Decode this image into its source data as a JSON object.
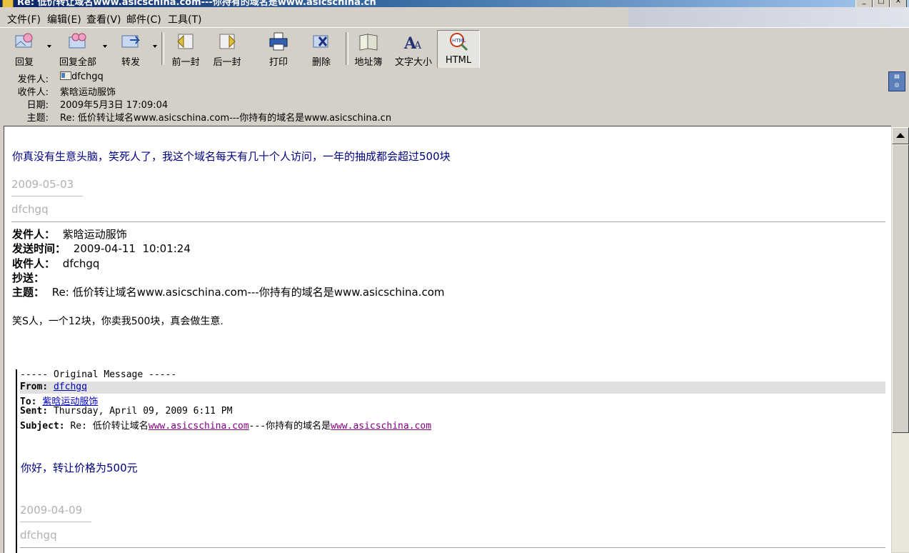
{
  "window": {
    "title": "Re: 低价转让域名www.asicschina.com---你持有的域名是www.asicschina.cn"
  },
  "menu": [
    "文件(F)",
    "编辑(E)",
    "查看(V)",
    "邮件(C)",
    "工具(T)"
  ],
  "toolbar": {
    "reply": "回复",
    "reply_all": "回复全部",
    "forward": "转发",
    "prev": "前一封",
    "next": "后一封",
    "print": "打印",
    "delete": "删除",
    "addressbook": "地址簿",
    "textsize": "文字大小",
    "html": "HTML"
  },
  "header": {
    "from_label": "发件人:",
    "from_value": "dfchgq",
    "to_label": "收件人:",
    "to_value": "紫晗运动服饰",
    "date_label": "日期:",
    "date_value": "2009年5月3日 17:09:04",
    "subject_label": "主题:",
    "subject_value": "Re: 低价转让域名www.asicschina.com---你持有的域名是www.asicschina.cn"
  },
  "body": {
    "reply_text": "你真没有生意头脑，笑死人了，我这个域名每天有几十个人访问，一年的抽成都会超过500块",
    "sig_date": "2009-05-03",
    "sig_name": "dfchgq",
    "q1": {
      "from_label": "发件人：",
      "from_value": "紫晗运动服饰",
      "sent_label": "发送时间：",
      "sent_value": "2009-04-11  10:01:24",
      "to_label": "收件人：",
      "to_value": "dfchgq",
      "cc_label": "抄送：",
      "subject_label": "主题：",
      "subject_value": "Re: 低价转让域名www.asicschina.com---你持有的域名是www.asicschina.com",
      "text": "笑S人，一个12块，你卖我500块，真会做生意."
    },
    "q2": {
      "orig_header": "----- Original Message -----",
      "from_label": "From:",
      "from_value": "dfchgq",
      "to_label": "To:",
      "to_value": "紫晗运动服饰",
      "sent_label": "Sent:",
      "sent_value": "Thursday, April 09, 2009 6:11 PM",
      "subject_label": "Subject:",
      "subject_pre": "Re: 低价转让域名",
      "subject_link1": "www.asicschina.com",
      "subject_mid": "---你持有的域名是",
      "subject_link2": "www.asicschina.com",
      "text": "你好，转让价格为500元",
      "sig_date": "2009-04-09",
      "sig_name": "dfchgq"
    }
  }
}
